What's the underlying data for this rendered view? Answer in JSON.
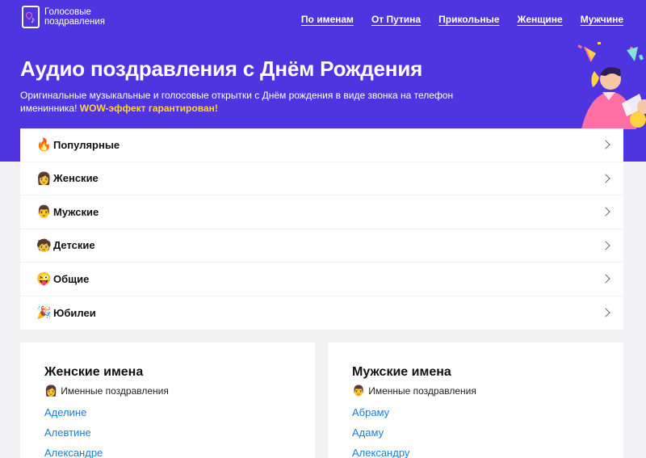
{
  "logo": {
    "line1": "Голосовые",
    "line2": "поздравления"
  },
  "nav": [
    "По именам",
    "От Путина",
    "Прикольные",
    "Женщине",
    "Мужчине"
  ],
  "hero": {
    "title": "Аудио поздравления с Днём Рождения",
    "subtitle": "Оригинальные музыкальные и голосовые открытки с Днём рождения в виде звонка на телефон именинника!",
    "accent": "WOW-эффект гарантирован!"
  },
  "categories": [
    {
      "emoji": "🔥",
      "label": "Популярные"
    },
    {
      "emoji": "👩",
      "label": "Женские"
    },
    {
      "emoji": "👨",
      "label": "Мужские"
    },
    {
      "emoji": "🧒",
      "label": "Детские"
    },
    {
      "emoji": "😜",
      "label": "Общие"
    },
    {
      "emoji": "🎉",
      "label": "Юбилеи"
    }
  ],
  "women": {
    "title": "Женские имена",
    "emoji": "👩",
    "sub": "Именные поздравления",
    "names": [
      "Аделине",
      "Алевтине",
      "Александре"
    ]
  },
  "men": {
    "title": "Мужские имена",
    "emoji": "👨",
    "sub": "Именные поздравления",
    "names": [
      "Абраму",
      "Адаму",
      "Александру"
    ]
  },
  "colors": {
    "hero": "#4f35e0",
    "accent": "#ffd23f",
    "link": "#1a7ed6"
  }
}
